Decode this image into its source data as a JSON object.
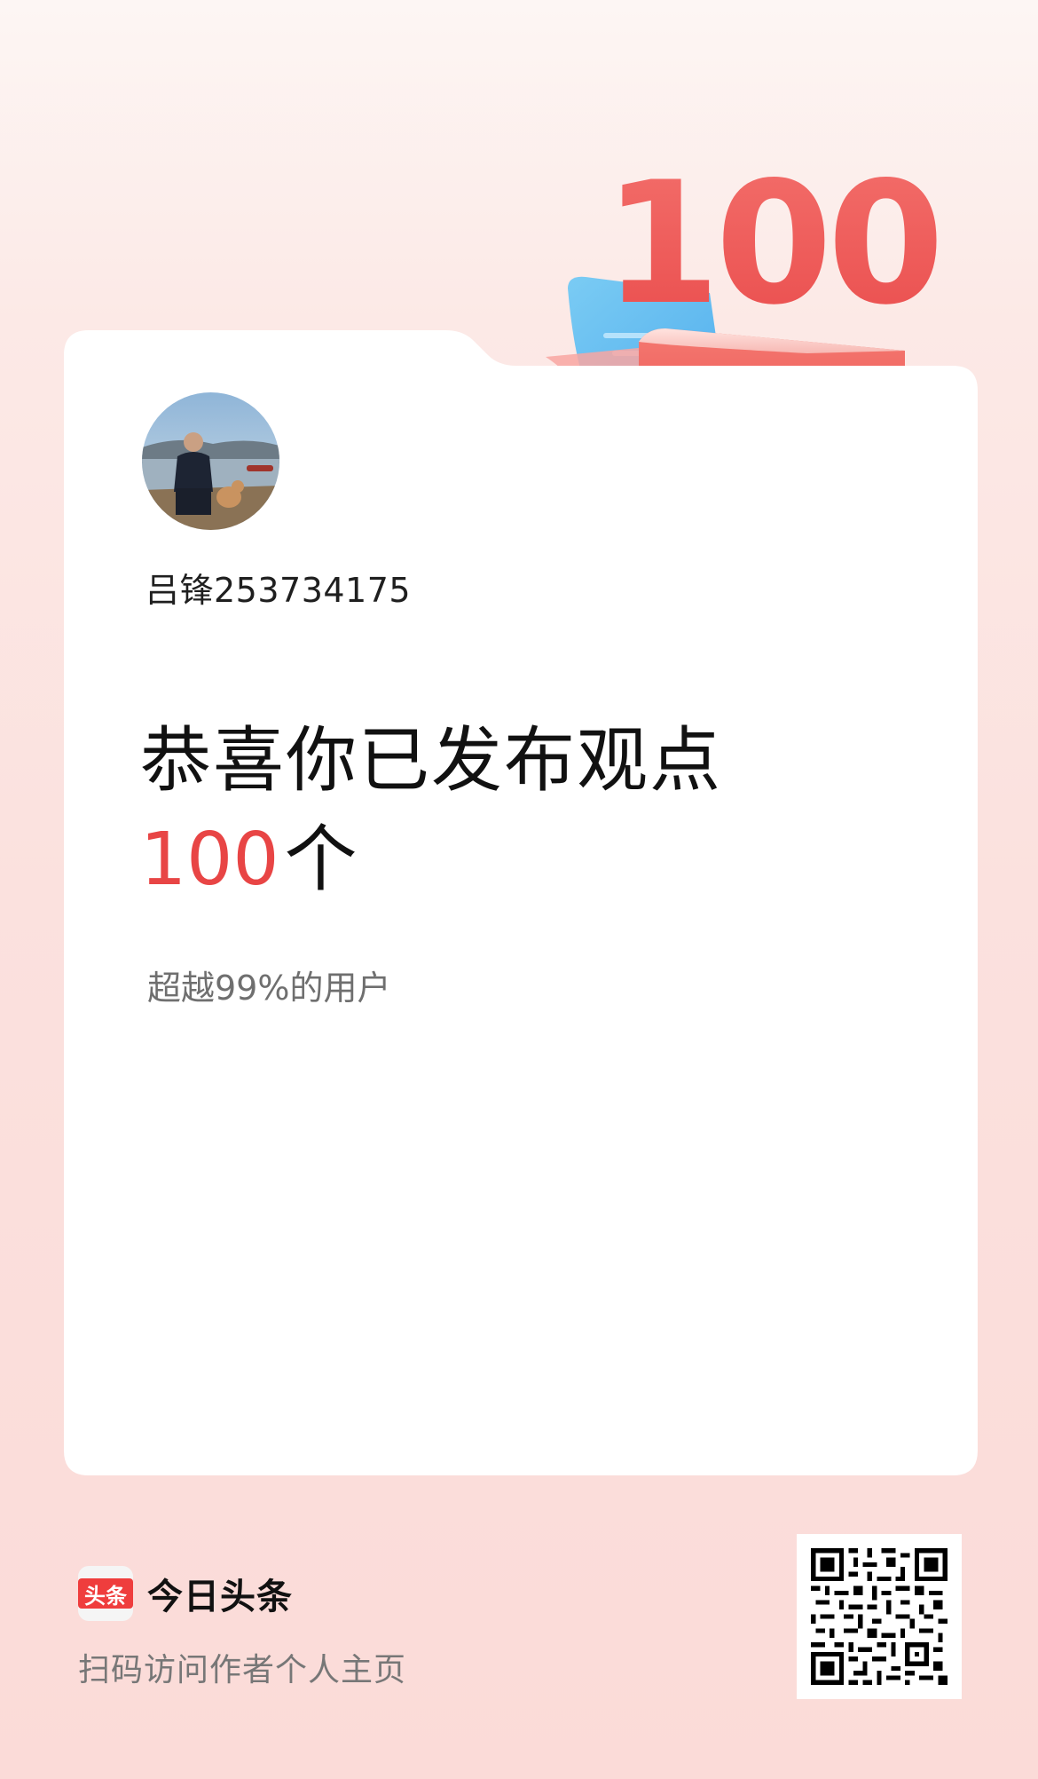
{
  "badge": {
    "number": "100"
  },
  "profile": {
    "avatar_icon": "user-photo-avatar",
    "username": "吕锋253734175"
  },
  "achievement": {
    "headline": "恭喜你已发布观点",
    "count": "100",
    "unit": "个",
    "rank_text": "超越99%的用户"
  },
  "footer": {
    "logo_text": "头条",
    "app_name": "今日头条",
    "hint": "扫码访问作者个人主页",
    "qr_icon": "qr-code-icon"
  },
  "colors": {
    "accent_red": "#e84545",
    "logo_red": "#ef3d3d"
  }
}
